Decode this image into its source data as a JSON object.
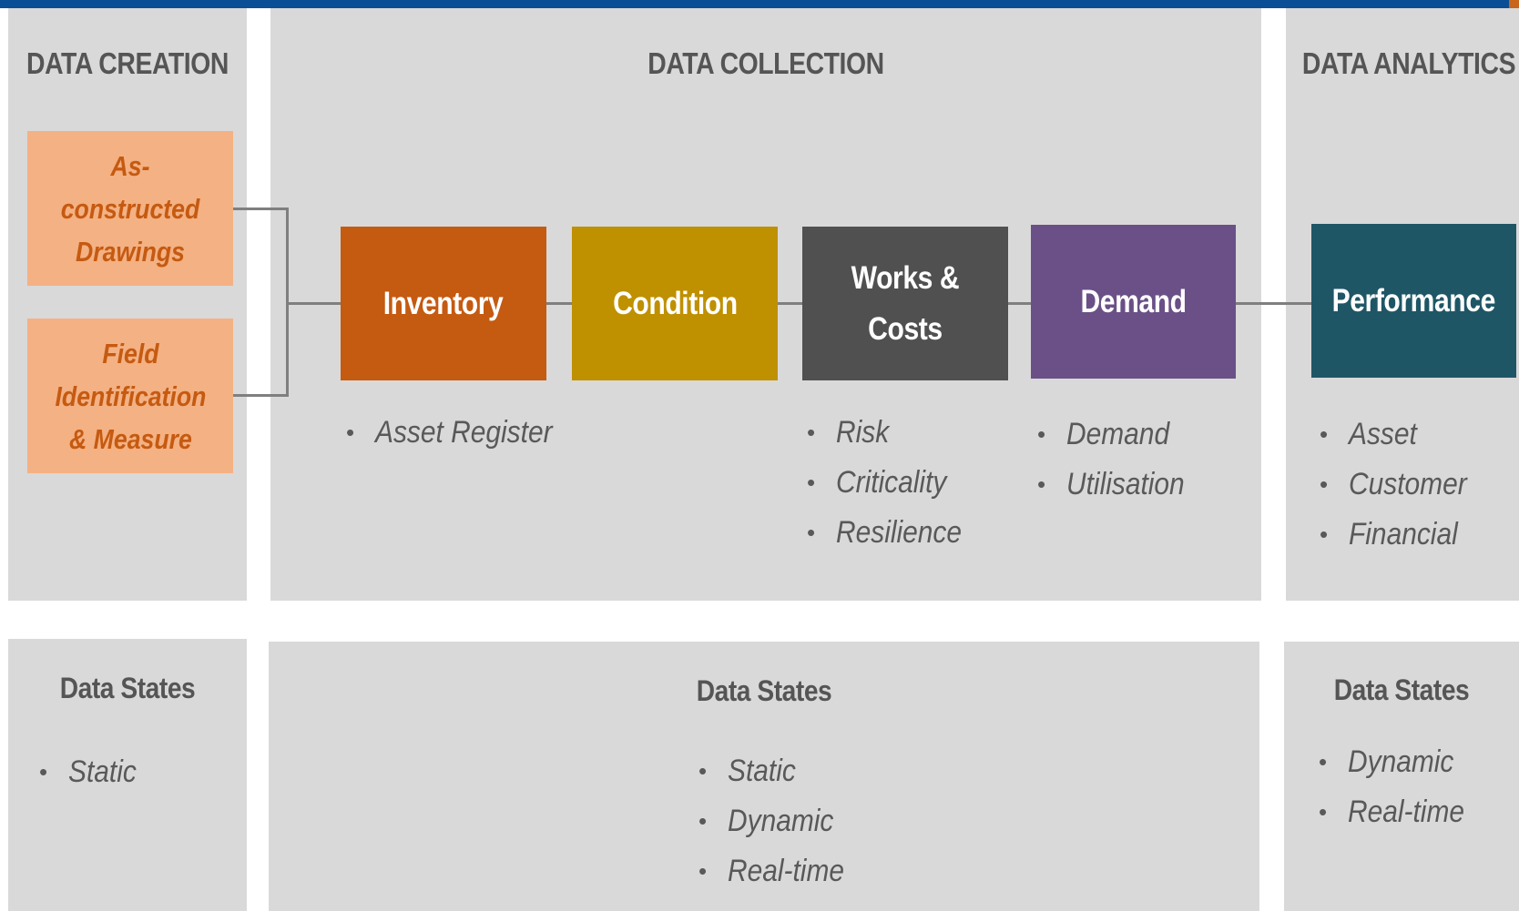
{
  "colors": {
    "top_bar": "#0a4f96",
    "panel_bg": "#d9d9d9",
    "source_box": "#f4b183",
    "source_text": "#c55a11",
    "inventory": "#c55a11",
    "condition": "#bf9000",
    "works_costs": "#505050",
    "demand": "#6a5087",
    "performance": "#1f5666",
    "connector": "#7f7f7f",
    "text_gray": "#555555"
  },
  "sections": {
    "creation": {
      "title": "DATA CREATION",
      "sources": [
        {
          "label": "As-constructed\nDrawings"
        },
        {
          "label": "Field\nIdentification\n& Measure"
        }
      ]
    },
    "collection": {
      "title": "DATA COLLECTION",
      "stages": [
        {
          "label": "Inventory",
          "bullets": [
            "Asset Register"
          ]
        },
        {
          "label": "Condition",
          "bullets": []
        },
        {
          "label": "Works &\nCosts",
          "bullets": [
            "Risk",
            "Criticality",
            "Resilience"
          ]
        },
        {
          "label": "Demand",
          "bullets": [
            "Demand",
            "Utilisation"
          ]
        }
      ]
    },
    "analytics": {
      "title": "DATA ANALYTICS",
      "stage": {
        "label": "Performance",
        "bullets": [
          "Asset",
          "Customer",
          "Financial"
        ]
      }
    }
  },
  "data_states": {
    "creation": {
      "title": "Data States",
      "items": [
        "Static"
      ]
    },
    "collection": {
      "title": "Data States",
      "items": [
        "Static",
        "Dynamic",
        "Real-time"
      ]
    },
    "analytics": {
      "title": "Data States",
      "items": [
        "Dynamic",
        "Real-time"
      ]
    }
  }
}
